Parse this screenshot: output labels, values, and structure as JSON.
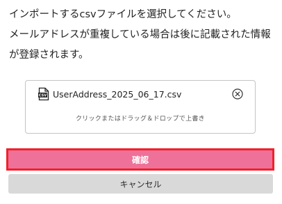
{
  "instructions": {
    "line1": "インポートするcsvファイルを選択してください。",
    "line2": "メールアドレスが重複している場合は後に記載された情報",
    "line3": "が登録されます。"
  },
  "dropzone": {
    "file_icon": "csv-file-icon",
    "file_name": "UserAddress_2025_06_17.csv",
    "remove_icon": "circle-x-icon",
    "hint": "クリックまたはドラッグ＆ドロップで上書き"
  },
  "actions": {
    "confirm_label": "確認",
    "cancel_label": "キャンセル"
  },
  "colors": {
    "confirm_bg": "#ee7199",
    "confirm_border": "#f2202a",
    "cancel_bg": "#d9d9d9"
  }
}
